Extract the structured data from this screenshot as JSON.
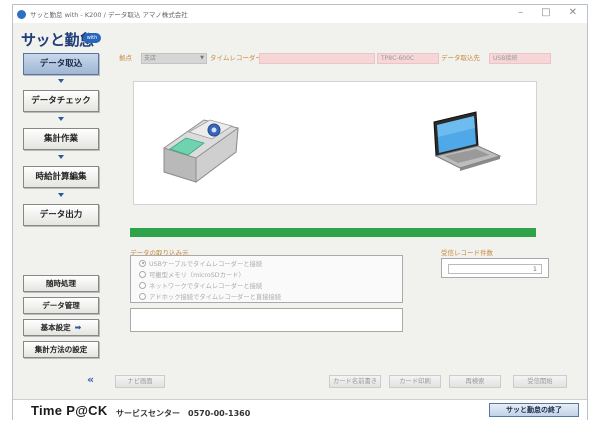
{
  "window": {
    "title": "サッと勤怠 with - K200 / データ取込  アマノ株式会社"
  },
  "logo": {
    "text": "サッと勤怠",
    "badge": "with"
  },
  "workflow_steps": [
    {
      "label": "データ取込",
      "active": true
    },
    {
      "label": "データチェック",
      "active": false
    },
    {
      "label": "集計作業",
      "active": false
    },
    {
      "label": "時給計算編集",
      "active": false
    },
    {
      "label": "データ出力",
      "active": false
    }
  ],
  "side_buttons": [
    {
      "label": "随時処理"
    },
    {
      "label": "データ管理"
    },
    {
      "label": "基本設定"
    },
    {
      "label": "集計方法の設定"
    }
  ],
  "fields": {
    "location_label": "拠点",
    "location_value": "支店",
    "recorder_label": "タイムレコーダー",
    "recorder_name": "",
    "recorder_model": "TP8C-600C",
    "source_label": "データ取込先",
    "source_value": "USB接続"
  },
  "retrieval": {
    "title": "データの取り込み元",
    "options": [
      {
        "label": "USBケーブルでタイムレコーダーと接続",
        "selected": true
      },
      {
        "label": "可搬型メモリ（microSDカード）",
        "selected": false
      },
      {
        "label": "ネットワークでタイムレコーダーと接続",
        "selected": false
      },
      {
        "label": "アドホック接続でタイムレコーダーと直接接続",
        "selected": false
      }
    ]
  },
  "received": {
    "title": "受信レコード件数",
    "count": "1"
  },
  "actions": {
    "nav": "ナビ画面",
    "card_name": "カード名前書き",
    "card_print": "カード印刷",
    "recheck": "再検索",
    "receive_start": "受信開始"
  },
  "footer": {
    "brand": "Time P@CK",
    "service": "サービスセンター　0570-00-1360",
    "exit": "サッと勤怠の終了"
  },
  "colors": {
    "accent": "#2c5aa0",
    "progress": "#2fa34a",
    "field_pink": "#f7d6d8",
    "label_orange": "#c88a3a"
  }
}
